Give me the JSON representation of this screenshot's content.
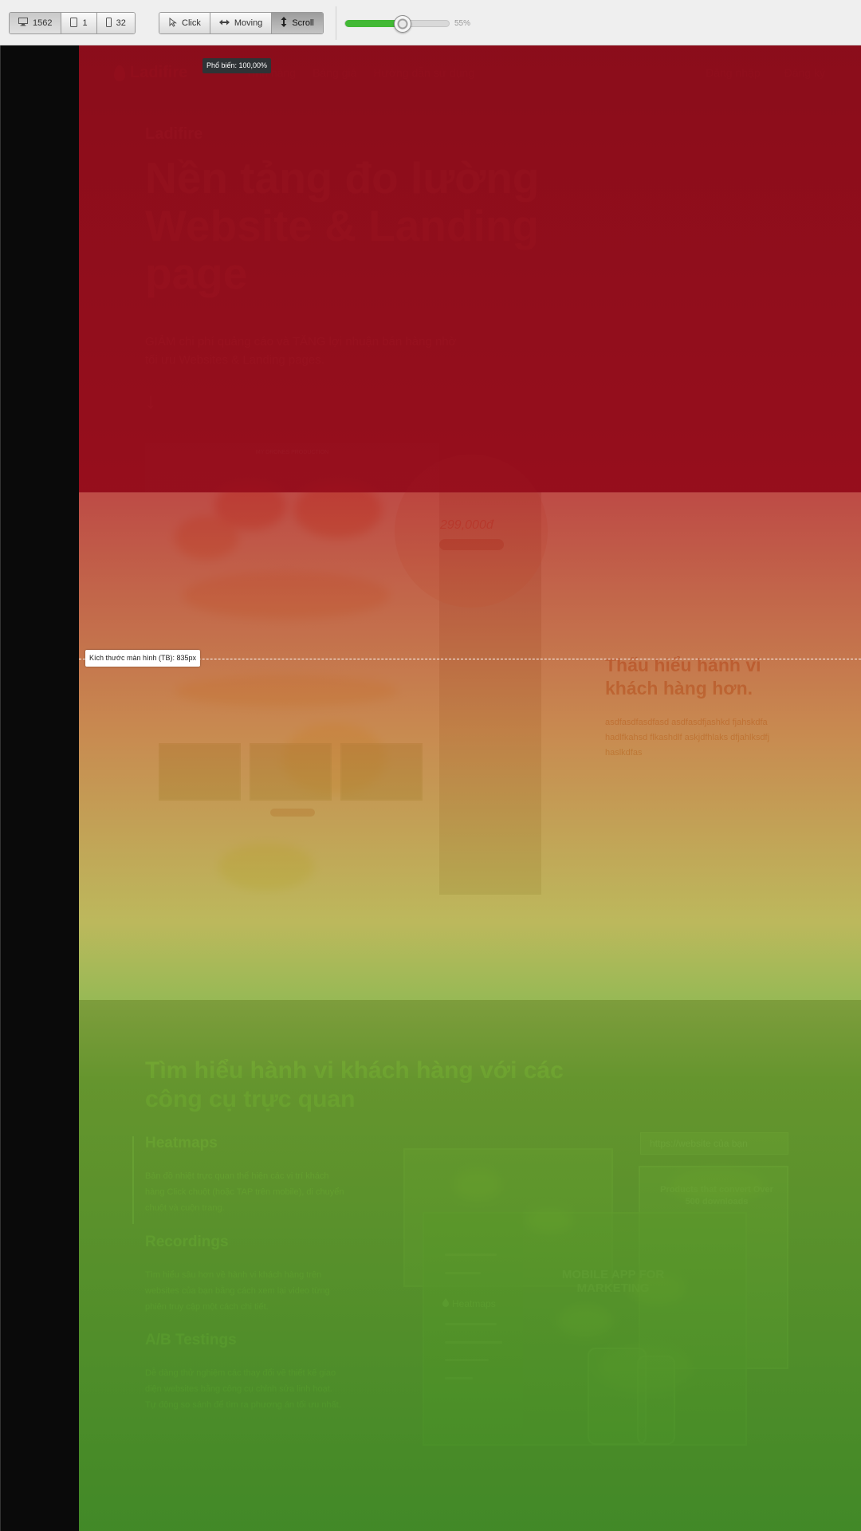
{
  "toolbar": {
    "device_counts": [
      {
        "icon": "desktop-icon",
        "value": "1562"
      },
      {
        "icon": "tablet-icon",
        "value": "1"
      },
      {
        "icon": "mobile-icon",
        "value": "32"
      }
    ],
    "modes": [
      {
        "icon": "pointer-icon",
        "label": "Click"
      },
      {
        "icon": "arrows-horizontal-icon",
        "label": "Moving"
      },
      {
        "icon": "arrows-vertical-icon",
        "label": "Scroll"
      }
    ],
    "opacity_percent": 55,
    "opacity_label": "55%"
  },
  "tooltip": {
    "text": "Phổ biến: 100,00%"
  },
  "screen_marker": {
    "text": "Kích thước màn hình (TB): 835px"
  },
  "page": {
    "nav": {
      "brand": "Ladifire",
      "links": [
        "Tính năng",
        "Bảng giá",
        "Hướng dẫn sử dụng"
      ],
      "right": [
        "Đăng nhập",
        "Đăng ký"
      ]
    },
    "hero": {
      "eyebrow": "Ladifire",
      "title": "Nền tảng đo lường Website & Landing page",
      "subtitle": "GIẢM chi phí quảng cáo và TĂNG lợi nhuận bán hàng nhờ tối ưu Websites & Landing pages.",
      "arrow": "↓",
      "mock_header": "MY DRONES PRODUCTION",
      "price": "299,000đ"
    },
    "section2": {
      "title": "Thấu hiểu hành vi khách hàng hơn.",
      "body": "asdfasdfasdfasd asdfasdfjashkd fjahskdfa hadlfkahsd flkashdlf askjdfhlaks dfjahlksdfj haslkdfas"
    },
    "section3": {
      "title": "Tìm hiểu hành vi khách hàng với các công cụ trực quan",
      "features": [
        {
          "title": "Heatmaps",
          "body": "Bản đồ nhiệt trực quan thể hiện các vị trí khách hàng Click chuột (hoặc TAP trên mobile), di chuyển chuột và cuộn trang."
        },
        {
          "title": "Recordings",
          "body": "Tìm hiểu sâu hơn về hành vi khách hàng trên websites của bạn bằng cách xem lại video từng phiên truy cập một cách chi tiết."
        },
        {
          "title": "A/B Testings",
          "body": "Dễ dàng thử nghiệm các thay đổi về thiết kế giao diện websites bằng công cụ chỉnh sửa linh hoạt. Tự động so sánh để tìm ra phương án tối ưu nhất."
        }
      ],
      "dashboard_label": "Heatmaps",
      "mobile_title": "MOBILE APP FOR MARKETING",
      "url_placeholder": "https://website của bạn",
      "side_card_text": "Products that convert Over 500 downloads"
    }
  }
}
